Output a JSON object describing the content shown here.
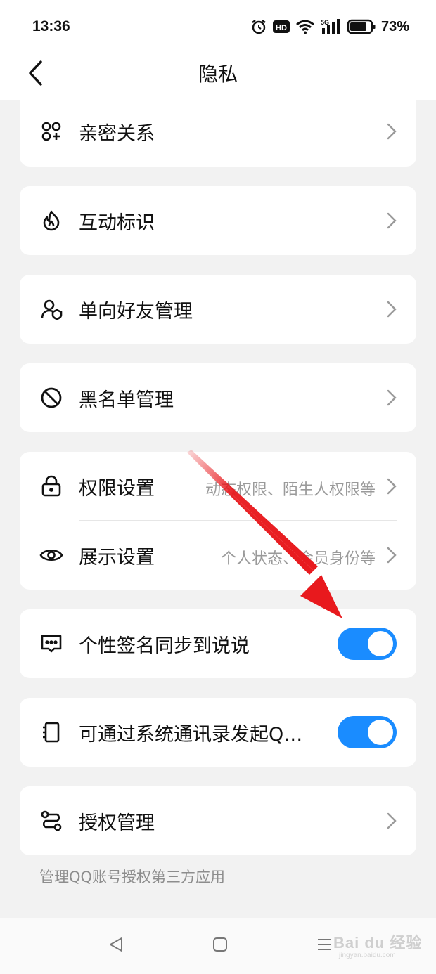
{
  "status_bar": {
    "time": "13:36",
    "battery_percent": "73%",
    "icons": [
      "alarm-icon",
      "hd-icon",
      "wifi-icon",
      "5g-signal-icon",
      "battery-icon"
    ],
    "hd_label": "HD",
    "network_label": "5G"
  },
  "header": {
    "title": "隐私",
    "back_icon": "chevron-left-icon"
  },
  "settings": {
    "intimate": {
      "label": "亲密关系",
      "icon": "intimate-relation-icon"
    },
    "interaction": {
      "label": "互动标识",
      "icon": "flame-icon"
    },
    "oneway": {
      "label": "单向好友管理",
      "icon": "user-shield-icon"
    },
    "blacklist": {
      "label": "黑名单管理",
      "icon": "block-icon"
    },
    "permission": {
      "label": "权限设置",
      "sub": "动态权限、陌生人权限等",
      "icon": "lock-icon"
    },
    "display": {
      "label": "展示设置",
      "sub": "个人状态、会员身份等",
      "icon": "eye-icon"
    },
    "signature": {
      "label": "个性签名同步到说说",
      "icon": "message-icon",
      "enabled": true
    },
    "contacts": {
      "label": "可通过系统通讯录发起Q…",
      "icon": "contact-book-icon",
      "enabled": true
    },
    "auth": {
      "label": "授权管理",
      "icon": "route-icon",
      "note": "管理QQ账号授权第三方应用"
    }
  },
  "colors": {
    "toggle_on": "#1a8cff",
    "annotation_arrow": "#e8191d",
    "background": "#f2f2f2"
  },
  "nav_bar": {
    "icons": [
      "nav-back-icon",
      "nav-home-icon",
      "nav-menu-icon"
    ]
  },
  "watermark": {
    "text": "Bai du 经验",
    "sub": "jingyan.baidu.com"
  }
}
